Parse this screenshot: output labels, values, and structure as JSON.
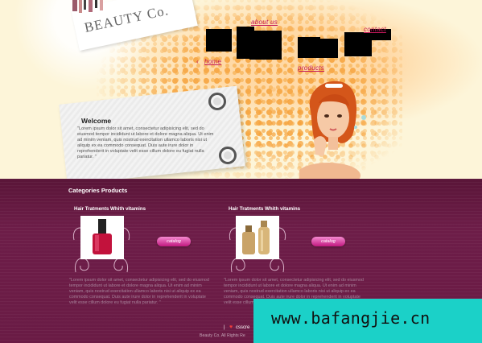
{
  "brand": {
    "logo_text": "BEAUTY Co."
  },
  "nav": {
    "top_link": "about us",
    "right_link": "contact",
    "left_link": "home",
    "bottom_link": "products"
  },
  "welcome": {
    "title": "Welcome",
    "text": "\"Lorem ipsum dolor sit amet, consectetur adipisicing elit, sed do eiusmod tempor incididunt ut labore et dolore magna aliqua. Ut enim ad minim veniam, quis nostrud exercitation ullamco laboris nisi ut aliquip ex ea commodo consequat. Duis aute irure dolor in reprehenderit in voluptate velit esse cillum dolore eu fugiat nulla pariatur. \""
  },
  "categories": {
    "title": "Categories Products",
    "products": [
      {
        "title": "Hair Tratments Whith vitamins",
        "button": "catalog",
        "image_icon": "nail-polish-icon",
        "description": "\"Lorem ipsum dolor sit amet, consectetur adipisicing elit, sed do eiusmod tempor incididunt ut labore et dolore magna aliqua. Ut enim ad minim veniam, quis nostrud exercitation ullamco laboris nisi ut aliquip ex ea commodo consequat. Duis aute irure dolor in reprehenderit in voluptate velit esse cillum dolore eu fugiat nulla pariatur. \""
      },
      {
        "title": "Hair Tratments Whith vitamins",
        "button": "catalog",
        "image_icon": "perfume-bottle-icon",
        "description": "\"Lorem ipsum dolor sit amet, consectetur adipisicing elit, sed do eiusmod tempor incididunt ut labore et dolore magna aliqua. Ut enim ad minim veniam, quis nostrud exercitation ullamco laboris nisi ut aliquip ex ea commodo consequat. Duis aute irure dolor in reprehenderit in voluptate velit esse cillum dolore eu fugiat nulla pariatur. \""
      }
    ]
  },
  "footer": {
    "pipe": "|",
    "link": "csscre",
    "copyright": "Beauty Co. All Rights Re"
  },
  "watermark": {
    "text": "www.bafangjie.cn"
  },
  "colors": {
    "accent_pink": "#c2185b",
    "content_bg": "#6a1b45",
    "dot_orange": "#f6a23a",
    "watermark_bg": "#1bd1c8"
  }
}
